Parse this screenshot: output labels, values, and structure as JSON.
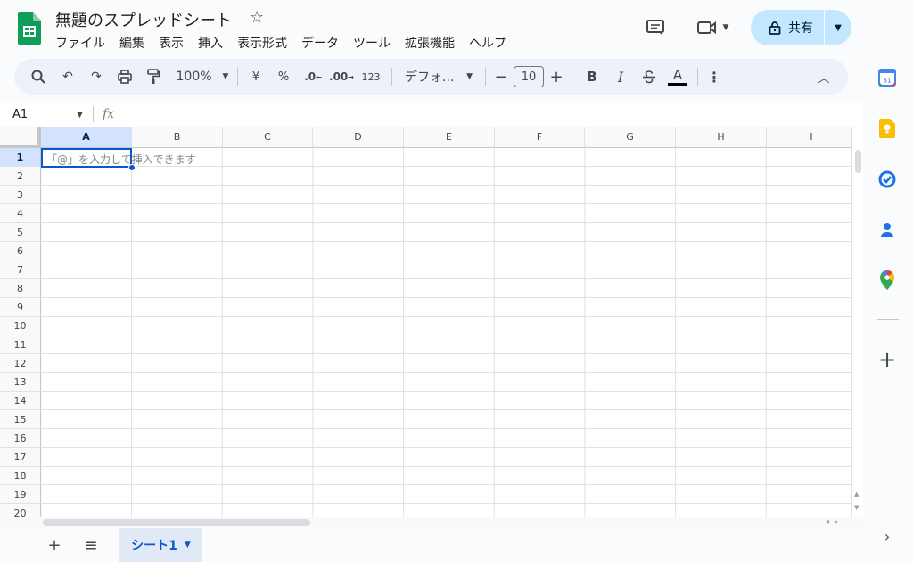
{
  "document": {
    "title": "無題のスプレッドシート"
  },
  "menu": [
    "ファイル",
    "編集",
    "表示",
    "挿入",
    "表示形式",
    "データ",
    "ツール",
    "拡張機能",
    "ヘルプ"
  ],
  "share": {
    "label": "共有"
  },
  "toolbar": {
    "zoom": "100%",
    "currency": "¥",
    "percent": "%",
    "decrease_decimal": ".0",
    "increase_decimal": ".00",
    "number_format": "123",
    "font": "デフォ...",
    "font_size": "10",
    "bold": "B",
    "italic": "I",
    "text_color": "A"
  },
  "formula_bar": {
    "name_box": "A1",
    "fx": "fx"
  },
  "grid": {
    "columns": [
      "A",
      "B",
      "C",
      "D",
      "E",
      "F",
      "G",
      "H",
      "I"
    ],
    "rows": [
      "1",
      "2",
      "3",
      "4",
      "5",
      "6",
      "7",
      "8",
      "9",
      "10",
      "11",
      "12",
      "13",
      "14",
      "15",
      "16",
      "17",
      "18",
      "19",
      "20"
    ],
    "selected_cell": "A1",
    "cell_hint": "「@」を入力して挿入できます"
  },
  "sheets": [
    {
      "name": "シート1",
      "active": true
    }
  ],
  "side_panel": {
    "icons": [
      "calendar-icon",
      "keep-icon",
      "tasks-icon",
      "contacts-icon",
      "maps-icon",
      "add-icon",
      "expand-icon"
    ],
    "calendar_day": "31"
  },
  "colors": {
    "accent": "#0b57d0",
    "share_bg": "#c2e7ff",
    "toolbar_bg": "#edf2fa",
    "sheets_green": "#0f9d58"
  }
}
